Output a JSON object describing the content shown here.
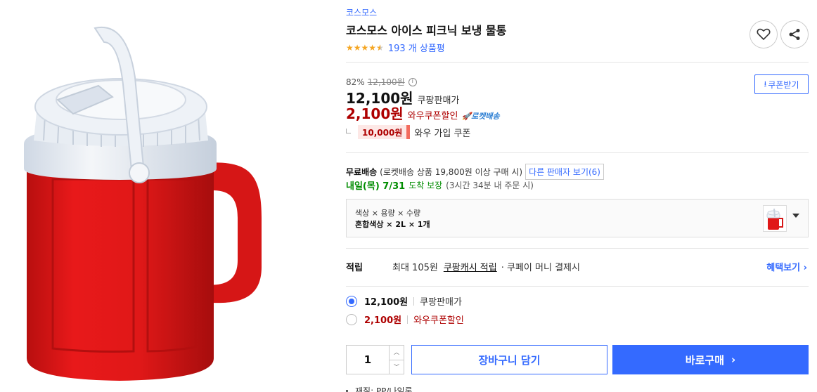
{
  "product": {
    "brand": "코스모스",
    "title": "코스모스 아이스 피크닉 보냉 물통",
    "rating": 4.5,
    "review_count": "193 개 상품평"
  },
  "actions": {
    "heart_icon": "heart-icon",
    "share_icon": "share-icon",
    "coupon_download": "쿠폰받기"
  },
  "price": {
    "discount_rate": "82%",
    "original_price": "12,100원",
    "sale_price": "12,100원",
    "sale_label": "쿠팡판매가",
    "coupon_price": "2,100원",
    "coupon_label": "와우쿠폰할인",
    "rocket_label": "로켓배송",
    "wow_coupon_amount": "10,000원",
    "wow_coupon_label": "와우 가입 쿠폰"
  },
  "shipping": {
    "free_label": "무료배송",
    "condition": "(로켓배송 상품 19,800원 이상 구매 시)",
    "other_sellers": "다른 판매자 보기(6)",
    "arrival": "내일(목) 7/31",
    "arrival_guarantee": "도착 보장",
    "arrival_deadline": "(3시간 34분 내 주문 시)"
  },
  "option": {
    "labels": "색상 × 용량 × 수량",
    "values": "혼합색상 × 2L × 1개"
  },
  "points": {
    "label": "적립",
    "max": "최대 105원",
    "link": "쿠팡캐시 적립",
    "tail": "· 쿠페이 머니 결제시",
    "benefit": "혜택보기 ›"
  },
  "price_options": [
    {
      "price": "12,100원",
      "label": "쿠팡판매가",
      "selected": true,
      "color": "#111111"
    },
    {
      "price": "2,100원",
      "label": "와우쿠폰할인",
      "selected": false,
      "color": "#ae0000"
    }
  ],
  "purchase": {
    "quantity": "1",
    "cart_label": "장바구니 담기",
    "buy_label": "바로구매"
  },
  "spec": {
    "text": "재질: PP/나일론"
  },
  "colors": {
    "accent": "#346aff",
    "sale_red": "#ae0000",
    "star": "#f5a623",
    "arrival_green": "#008c00"
  }
}
